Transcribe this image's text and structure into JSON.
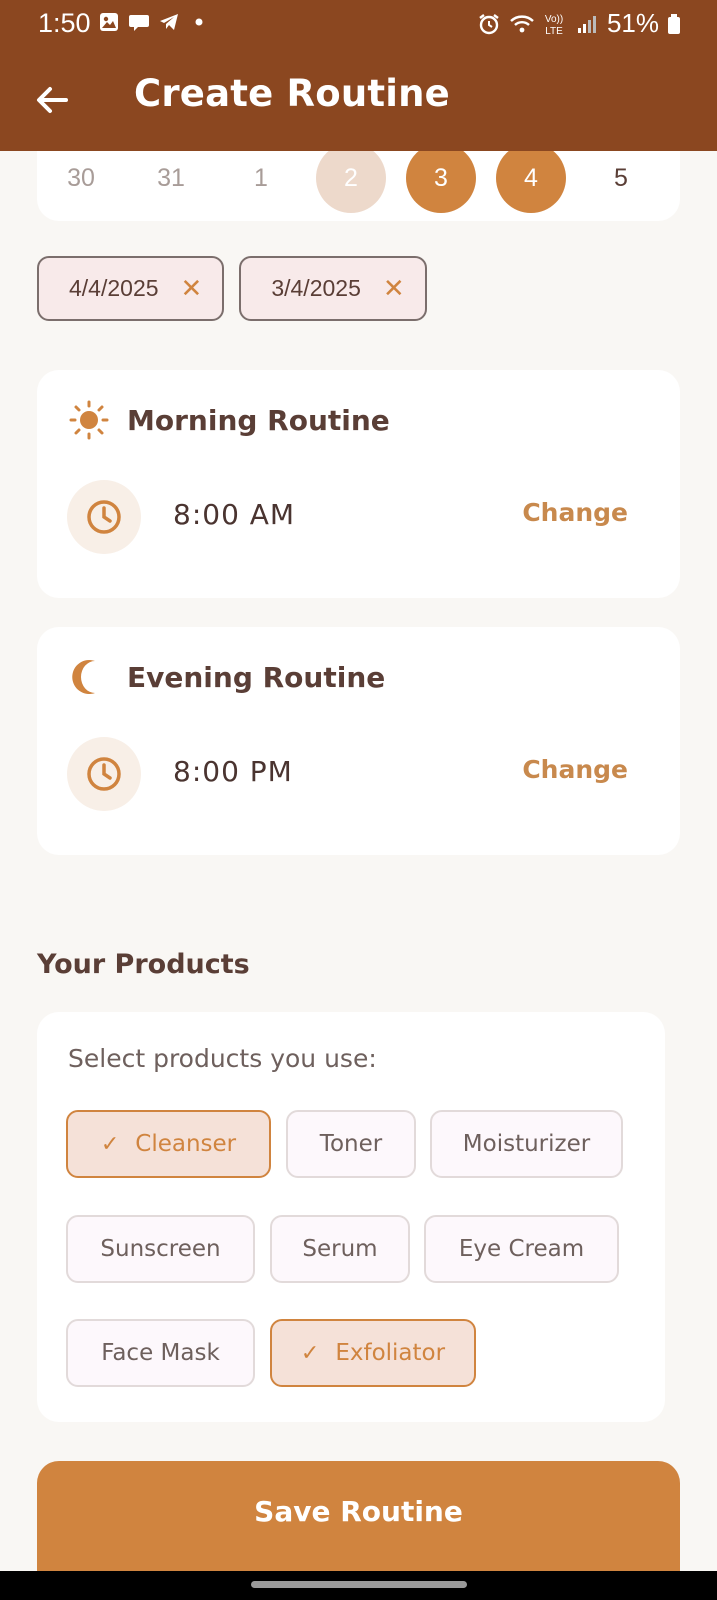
{
  "status_bar": {
    "time": "1:50",
    "battery": "51%",
    "network": "LTE",
    "notification_icons": [
      "gallery-icon",
      "chat-icon",
      "telegram-icon",
      "dot-icon"
    ]
  },
  "app_bar": {
    "title": "Create Routine",
    "back_icon": "arrow-left-icon"
  },
  "calendar": {
    "days": [
      {
        "label": "30",
        "state": "other-month"
      },
      {
        "label": "31",
        "state": "other-month"
      },
      {
        "label": "1",
        "state": "other-month"
      },
      {
        "label": "2",
        "state": "in-range"
      },
      {
        "label": "3",
        "state": "selected"
      },
      {
        "label": "4",
        "state": "selected"
      },
      {
        "label": "5",
        "state": "normal"
      }
    ]
  },
  "selected_dates": [
    {
      "label": "4/4/2025"
    },
    {
      "label": "3/4/2025"
    }
  ],
  "morning": {
    "title": "Morning Routine",
    "time": "8:00 AM",
    "change": "Change",
    "icon": "sun-icon"
  },
  "evening": {
    "title": "Evening Routine",
    "time": "8:00 PM",
    "change": "Change",
    "icon": "moon-icon"
  },
  "products": {
    "section_title": "Your Products",
    "prompt": "Select products you use:",
    "items": [
      {
        "label": "Cleanser",
        "selected": true
      },
      {
        "label": "Toner",
        "selected": false
      },
      {
        "label": "Moisturizer",
        "selected": false
      },
      {
        "label": "Sunscreen",
        "selected": false
      },
      {
        "label": "Serum",
        "selected": false
      },
      {
        "label": "Eye Cream",
        "selected": false
      },
      {
        "label": "Face Mask",
        "selected": false
      },
      {
        "label": "Exfoliator",
        "selected": true
      }
    ]
  },
  "save_button": {
    "label": "Save Routine"
  },
  "colors": {
    "header": "#8B4720",
    "accent": "#D0843F",
    "background": "#F9F7F4",
    "text": "#5A3E36"
  }
}
